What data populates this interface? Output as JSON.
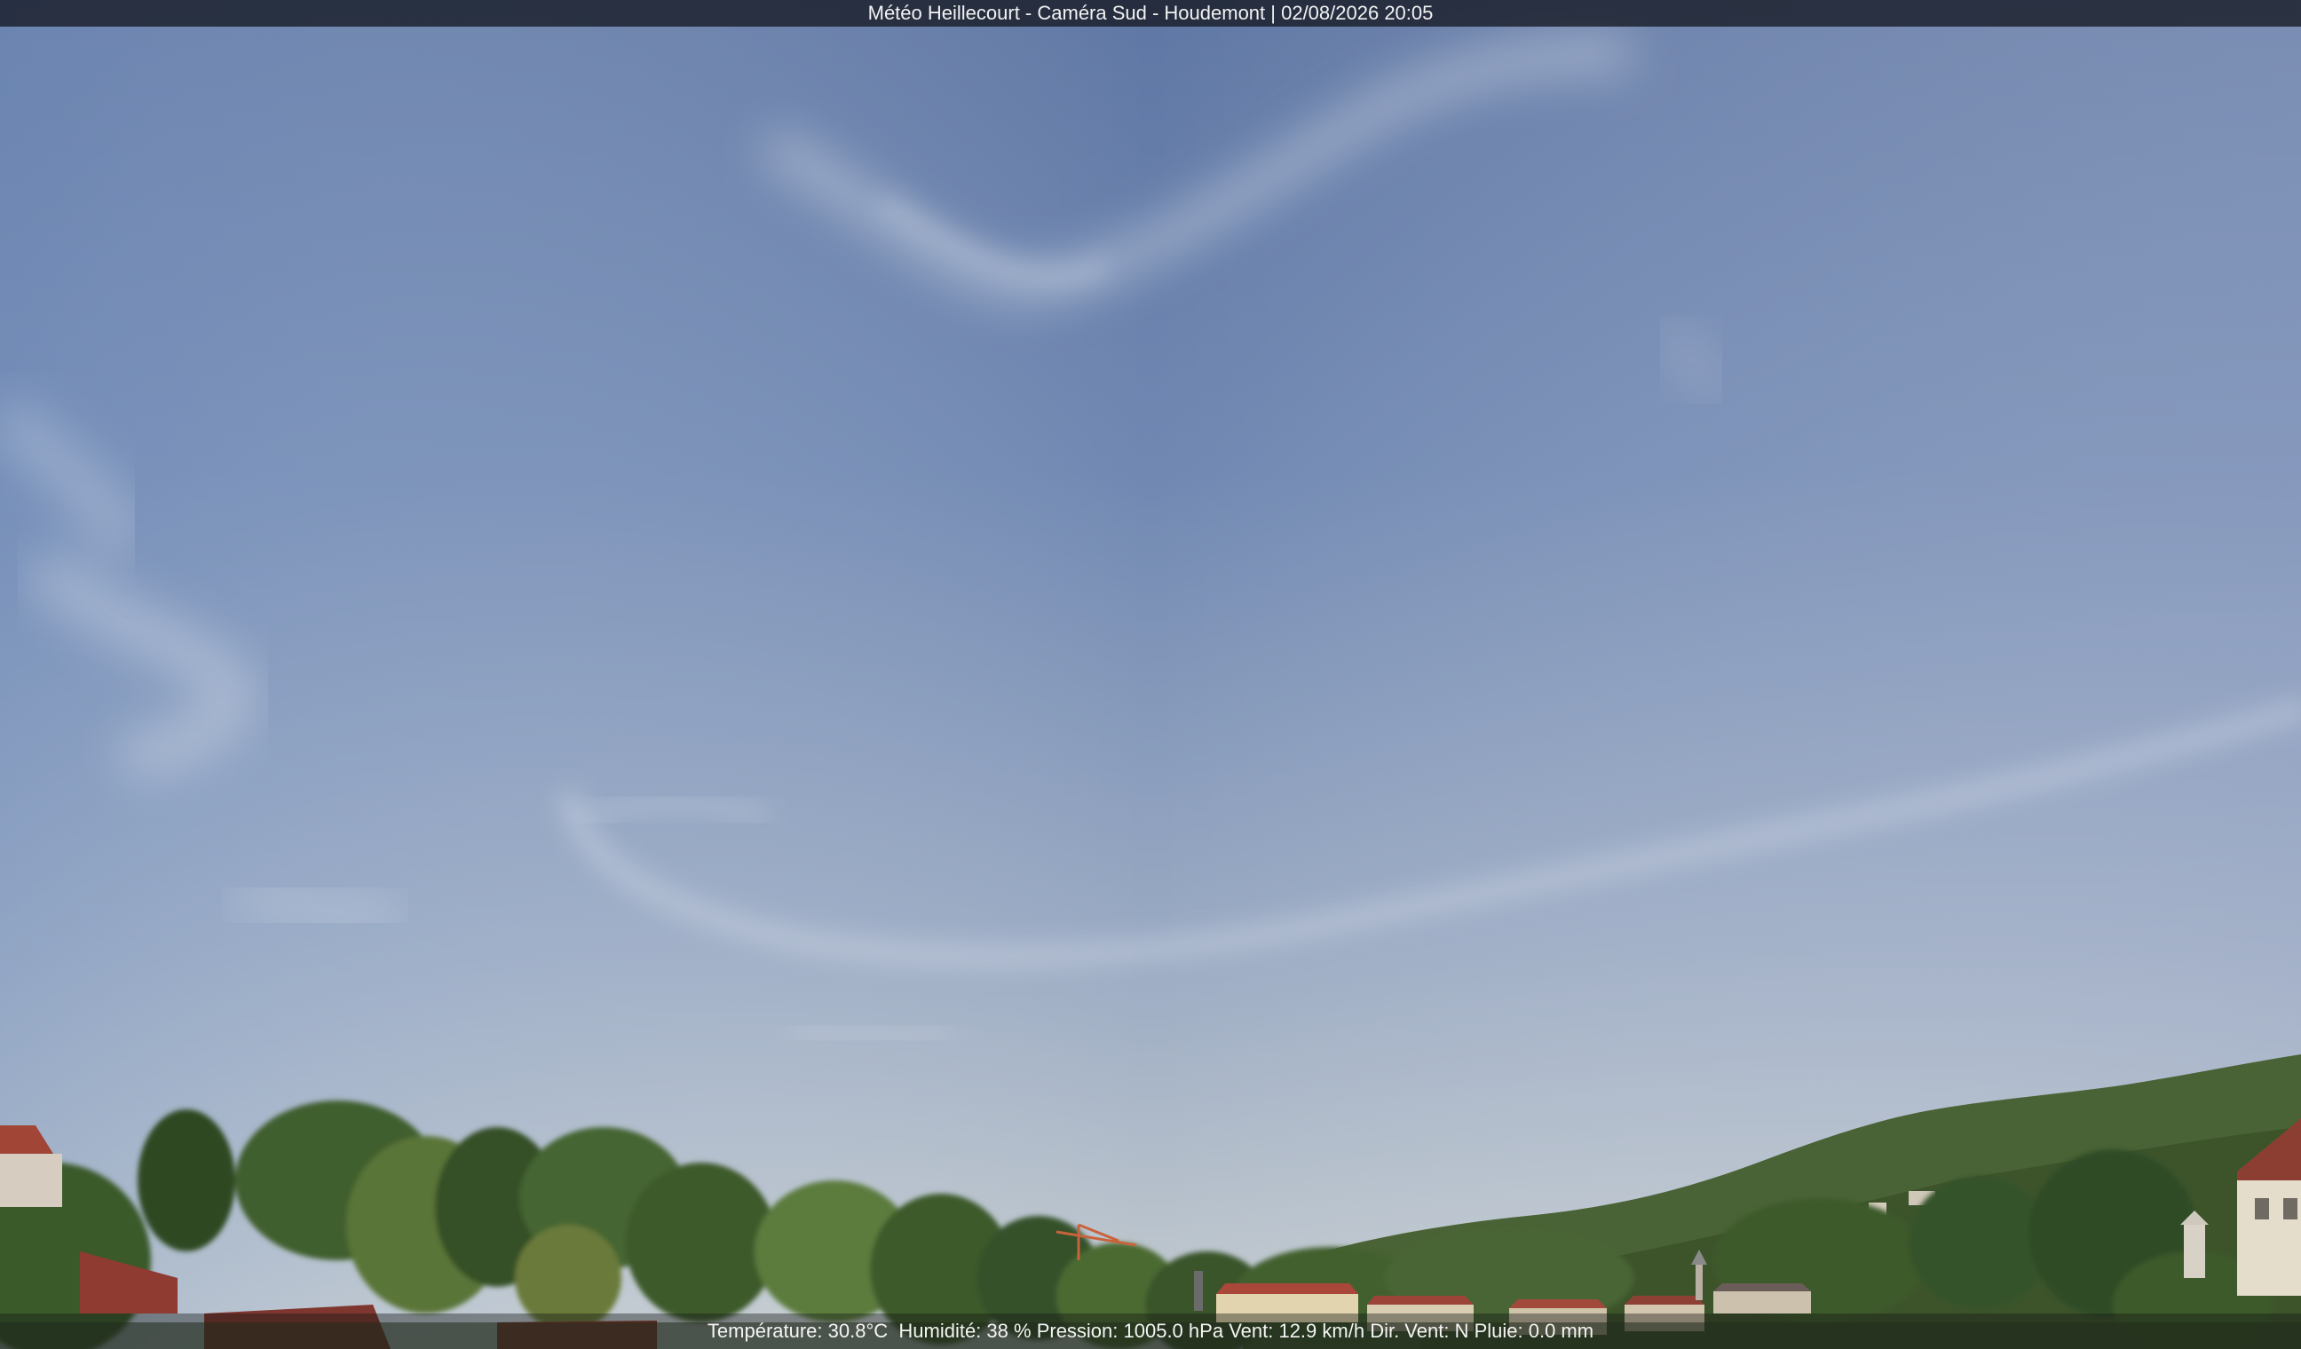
{
  "overlay": {
    "title": "Météo Heillecourt - Caméra Sud - Houdemont | 02/08/2026 20:05",
    "weather": {
      "temperature": "Température: 30.8°C",
      "humidity": "Humidité: 38 %",
      "pressure": "Pression: 1005.0 hPa",
      "wind": "Vent: 12.9 km/h",
      "wind_dir": "Dir. Vent: N",
      "rain": "Pluie: 0.0 mm"
    }
  },
  "scene": {
    "sky_top": "#5f7aa6",
    "sky_mid": "#7f97bd",
    "sky_horizon": "#c3ccd2",
    "foliage": "#3d5a2a",
    "roof": "#a4453a"
  }
}
